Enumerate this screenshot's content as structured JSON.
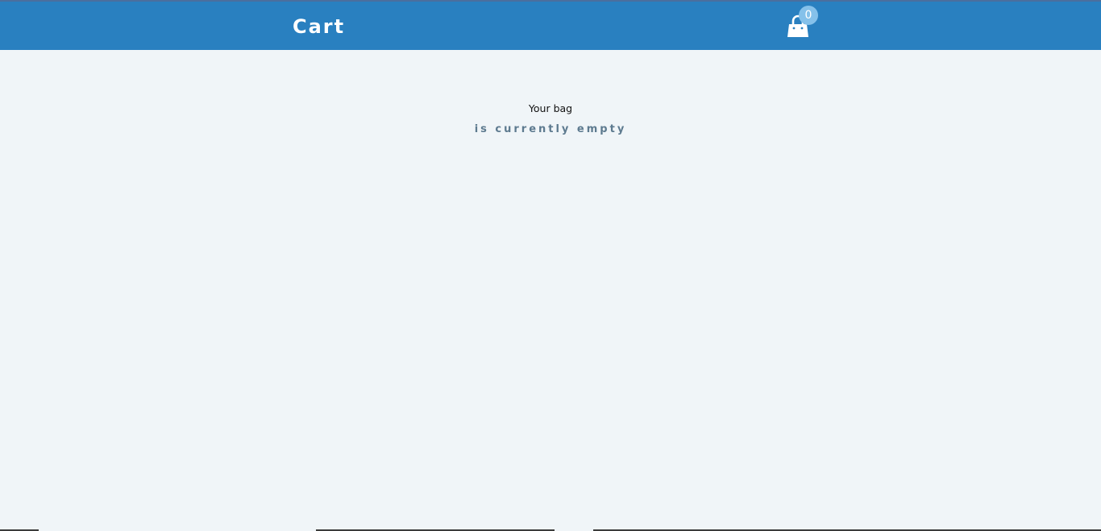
{
  "header": {
    "title": "Cart",
    "bag": {
      "icon": "shopping-bag-icon",
      "count": "0"
    }
  },
  "cart": {
    "empty_line1": "Your bag",
    "empty_line2": "is currently empty"
  },
  "colors": {
    "header_bg": "#2980c0",
    "page_bg": "#f0f5f8",
    "badge_bg": "#85c1ea",
    "subtitle": "#5d7a8f"
  }
}
